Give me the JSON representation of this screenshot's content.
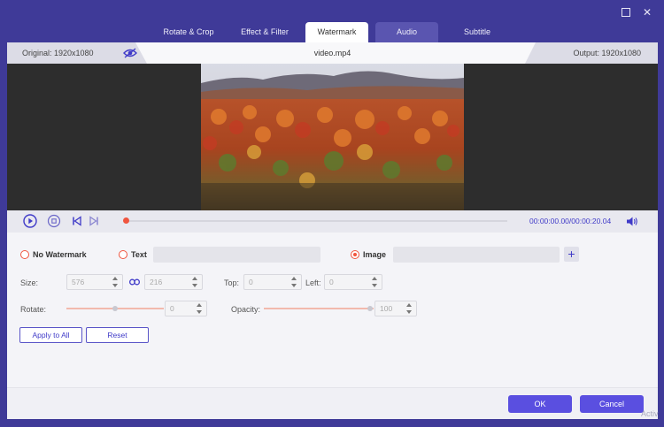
{
  "window": {
    "maximize_icon": "maximize-icon",
    "close_icon": "close-icon"
  },
  "tabs": [
    {
      "label": "Rotate & Crop"
    },
    {
      "label": "Effect & Filter"
    },
    {
      "label": "Watermark"
    },
    {
      "label": "Audio"
    },
    {
      "label": "Subtitle"
    }
  ],
  "info": {
    "original": "Original: 1920x1080",
    "filename": "video.mp4",
    "output": "Output: 1920x1080"
  },
  "playback": {
    "current_time": "00:00:00.00",
    "total_time": "/00:00:20.04",
    "progress": 0
  },
  "watermark": {
    "no_watermark_label": "No Watermark",
    "text_label": "Text",
    "image_label": "Image",
    "selected": "image",
    "text_value": "",
    "image_value": ""
  },
  "size": {
    "label": "Size:",
    "width": "576",
    "height": "216"
  },
  "position": {
    "top_label": "Top:",
    "top": "0",
    "left_label": "Left:",
    "left": "0"
  },
  "rotate": {
    "label": "Rotate:",
    "value": "0"
  },
  "opacity": {
    "label": "Opacity:",
    "value": "100"
  },
  "buttons": {
    "apply_all": "Apply to All",
    "reset": "Reset",
    "ok": "OK",
    "cancel": "Cancel"
  },
  "activation_text": "Activ",
  "colors": {
    "accent": "#3f3ac8",
    "radio": "#f0553f",
    "primary": "#5a4fe0",
    "background": "#3f3a98"
  }
}
